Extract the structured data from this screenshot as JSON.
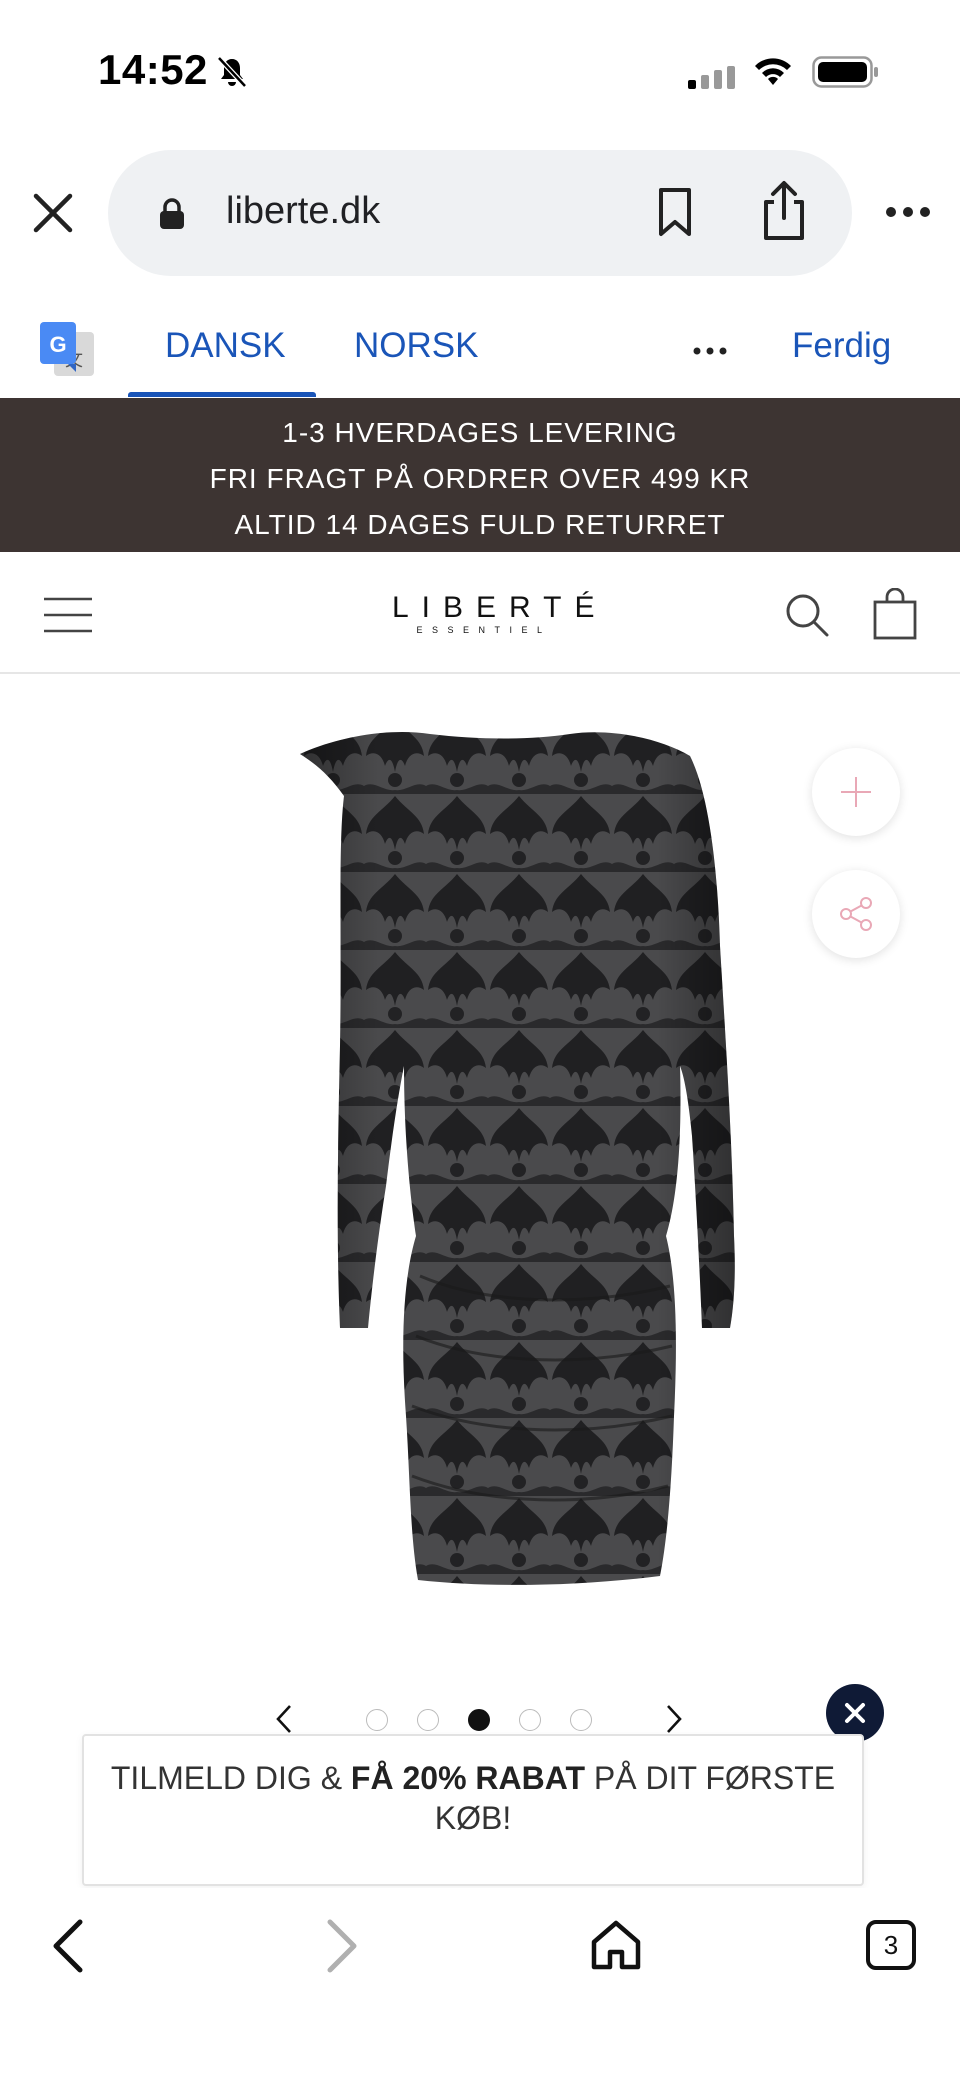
{
  "status_bar": {
    "time": "14:52"
  },
  "browser": {
    "url": "liberte.dk"
  },
  "translate_bar": {
    "tabs": [
      {
        "label": "DANSK",
        "active": true
      },
      {
        "label": "NORSK",
        "active": false
      }
    ],
    "done_label": "Ferdig",
    "accent_color": "#1a55b8"
  },
  "promo": {
    "lines": [
      "1-3 HVERDAGES LEVERING",
      "FRI FRAGT PÅ ORDRER OVER 499 KR",
      "ALTID 14 DAGES FULD RETURRET"
    ],
    "background_color": "#3d3432"
  },
  "header": {
    "logo_main": "LIBERTÉ",
    "logo_sub": "ESSENTIEL"
  },
  "gallery": {
    "slide_count": 5,
    "active_slide": 3
  },
  "newsletter": {
    "text_before": "TILMELD DIG & ",
    "text_bold": "FÅ 20% RABAT",
    "text_after": " PÅ DIT FØRSTE KØB!"
  },
  "toolbar": {
    "tab_count": "3"
  }
}
